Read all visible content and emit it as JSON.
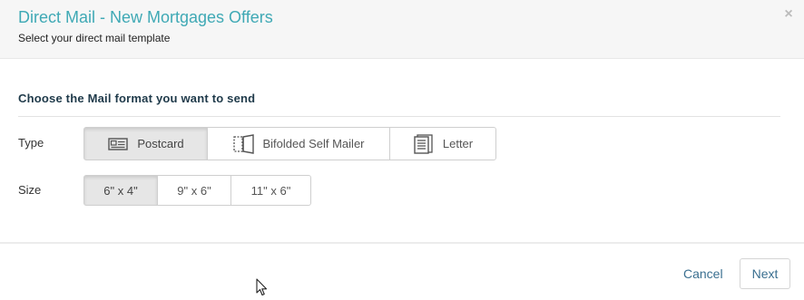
{
  "dialog": {
    "title": "Direct Mail - New Mortgages Offers",
    "subtitle": "Select your direct mail template",
    "close_glyph": "×"
  },
  "section": {
    "title": "Choose the Mail format you want to send"
  },
  "type_row": {
    "label": "Type",
    "options": [
      {
        "label": "Postcard",
        "icon": "postcard-icon",
        "selected": true
      },
      {
        "label": "Bifolded Self Mailer",
        "icon": "bifold-icon",
        "selected": false
      },
      {
        "label": "Letter",
        "icon": "letter-icon",
        "selected": false
      }
    ]
  },
  "size_row": {
    "label": "Size",
    "options": [
      {
        "label": "6\" x 4\"",
        "selected": true
      },
      {
        "label": "9\" x 6\"",
        "selected": false
      },
      {
        "label": "11\" x 6\"",
        "selected": false
      }
    ]
  },
  "footer": {
    "cancel_label": "Cancel",
    "next_label": "Next"
  },
  "colors": {
    "title": "#3fa9b5",
    "link": "#3a6f90",
    "selected_bg": "#e6e6e6"
  }
}
